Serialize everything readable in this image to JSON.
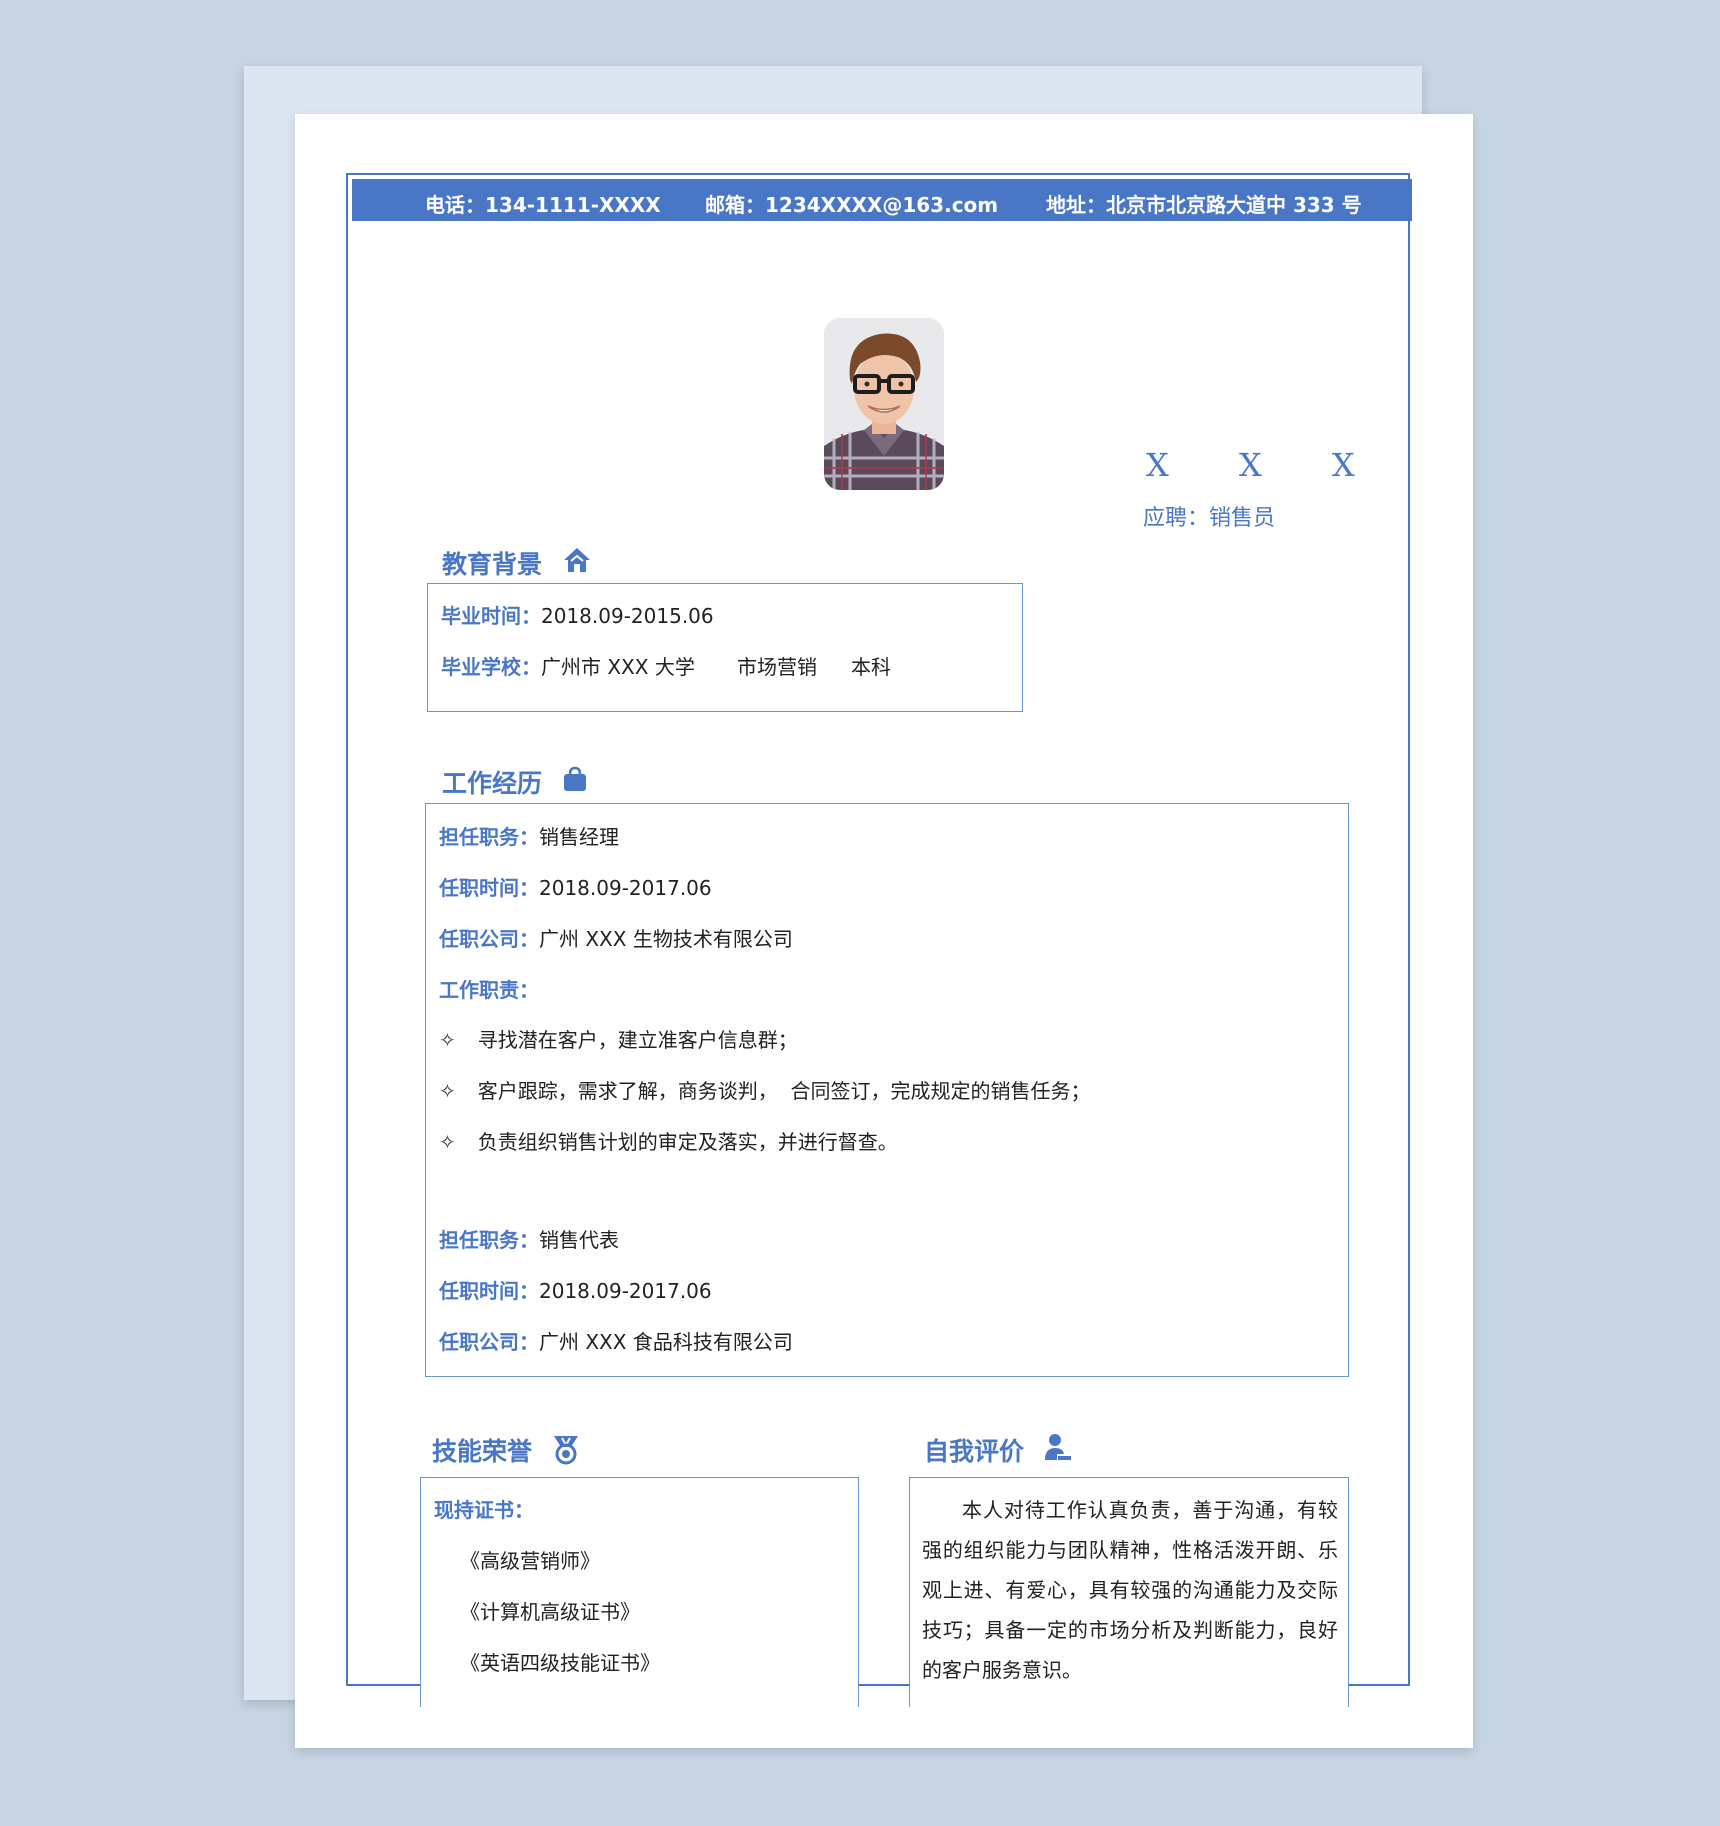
{
  "contact": {
    "phone": "电话：134-1111-XXXX",
    "email": "邮箱：1234XXXX@163.com",
    "address": "地址：北京市北京路大道中 333 号"
  },
  "profile": {
    "name": "X X X",
    "apply": "应聘：销售员"
  },
  "education": {
    "title": "教育背景",
    "icon": "home-icon",
    "time_label": "毕业时间：",
    "time_value": "2018.09-2015.06",
    "school_label": "毕业学校：",
    "school_value": "广州市 XXX 大学",
    "major": "市场营销",
    "degree": "本科"
  },
  "work": {
    "title": "工作经历",
    "icon": "briefcase-icon",
    "jobs": [
      {
        "position_label": "担任职务：",
        "position": "销售经理",
        "time_label": "任职时间：",
        "time": "2018.09-2017.06",
        "company_label": "任职公司：",
        "company": "广州 XXX 生物技术有限公司",
        "duties_label": "工作职责：",
        "duties": [
          "寻找潜在客户，建立准客户信息群；",
          "客户跟踪，需求了解，商务谈判，  合同签订，完成规定的销售任务；",
          "负责组织销售计划的审定及落实，并进行督查。"
        ]
      },
      {
        "position_label": "担任职务：",
        "position": "销售代表",
        "time_label": "任职时间：",
        "time": "2018.09-2017.06",
        "company_label": "任职公司：",
        "company": "广州 XXX 食品科技有限公司"
      }
    ],
    "bullet": "✧"
  },
  "skills": {
    "title": "技能荣誉",
    "icon": "medal-icon",
    "cert_label": "现持证书：",
    "certs": [
      "《高级营销师》",
      "《计算机高级证书》",
      "《英语四级技能证书》"
    ]
  },
  "self": {
    "title": "自我评价",
    "icon": "user-icon",
    "text": "本人对待工作认真负责，善于沟通，有较强的组织能力与团队精神，性格活泼开朗、乐观上进、有爱心，具有较强的沟通能力及交际技巧；具备一定的市场分析及判断能力，良好的客户服务意识。"
  },
  "colors": {
    "accent": "#4a76c6",
    "page_bg": "#c6d4e3",
    "back_sheet": "#dce6f3"
  }
}
